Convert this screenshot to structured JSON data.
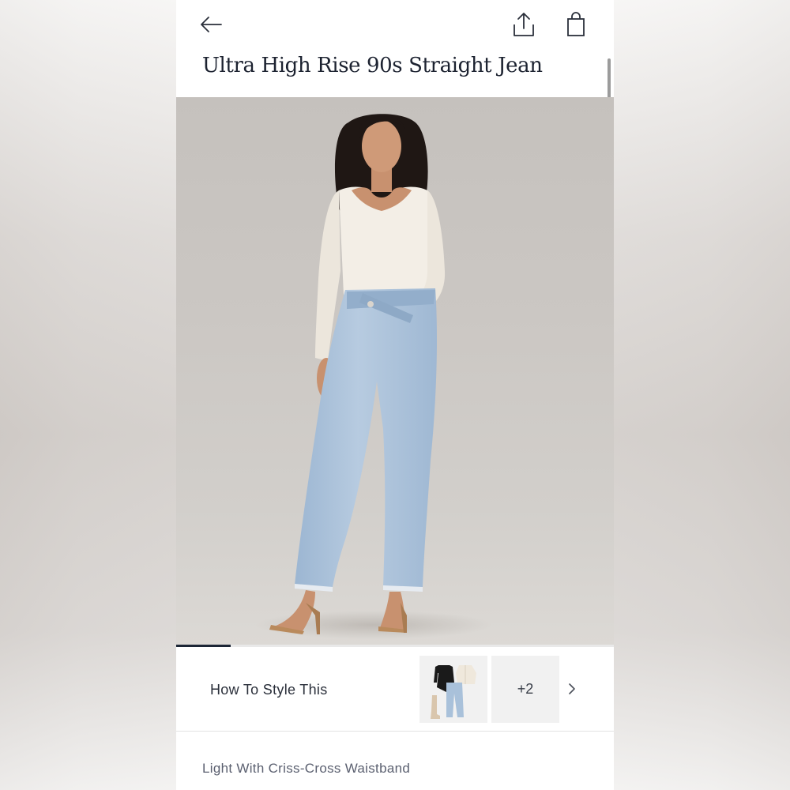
{
  "header": {
    "back_icon": "arrow-left-icon",
    "share_icon": "share-icon",
    "bag_icon": "shopping-bag-icon"
  },
  "product": {
    "title": "Ultra High Rise 90s Straight Jean",
    "color_name": "Light With Criss-Cross Waistband"
  },
  "carousel": {
    "current_position_fraction": 0.125
  },
  "style_section": {
    "label": "How To Style This",
    "more_count": "+2",
    "chevron_icon": "chevron-right-icon"
  },
  "colors": {
    "title_text": "#1c2230",
    "indicator": "#1c2636",
    "denim": "#a9c1da",
    "sweater": "#f3eee6"
  }
}
